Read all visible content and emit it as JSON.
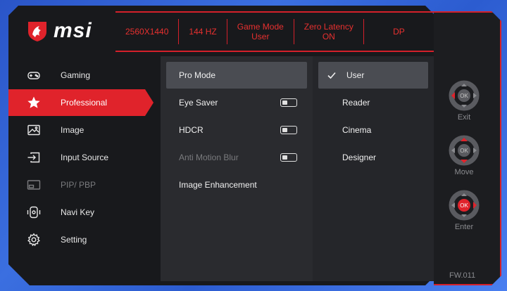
{
  "brand": {
    "name": "msi",
    "color": "#e0232b"
  },
  "status": [
    {
      "line1": "2560X1440",
      "line2": ""
    },
    {
      "line1": "144 HZ",
      "line2": ""
    },
    {
      "line1": "Game Mode",
      "line2": "User"
    },
    {
      "line1": "Zero Latency",
      "line2": "ON"
    },
    {
      "line1": "DP",
      "line2": ""
    }
  ],
  "nav": {
    "items": [
      {
        "label": "Gaming",
        "icon": "gamepad-icon"
      },
      {
        "label": "Professional",
        "icon": "star-icon",
        "active": true
      },
      {
        "label": "Image",
        "icon": "image-icon"
      },
      {
        "label": "Input Source",
        "icon": "input-source-icon"
      },
      {
        "label": "PIP/ PBP",
        "icon": "pip-icon",
        "disabled": true
      },
      {
        "label": "Navi Key",
        "icon": "navi-key-icon"
      },
      {
        "label": "Setting",
        "icon": "gear-icon"
      }
    ]
  },
  "professional": {
    "items": [
      {
        "label": "Pro Mode",
        "selected": true
      },
      {
        "label": "Eye Saver",
        "toggle": "off"
      },
      {
        "label": "HDCR",
        "toggle": "off"
      },
      {
        "label": "Anti Motion Blur",
        "toggle": "off",
        "disabled": true
      },
      {
        "label": "Image Enhancement"
      }
    ]
  },
  "pro_mode": {
    "items": [
      {
        "label": "User",
        "checked": true
      },
      {
        "label": "Reader"
      },
      {
        "label": "Cinema"
      },
      {
        "label": "Designer"
      }
    ]
  },
  "keys": [
    {
      "label": "Exit",
      "center": "OK",
      "icon": "dpad-exit-icon"
    },
    {
      "label": "Move",
      "center": "OK",
      "icon": "dpad-move-icon"
    },
    {
      "label": "Enter",
      "center": "OK",
      "icon": "dpad-enter-icon"
    }
  ],
  "firmware": "FW.011"
}
